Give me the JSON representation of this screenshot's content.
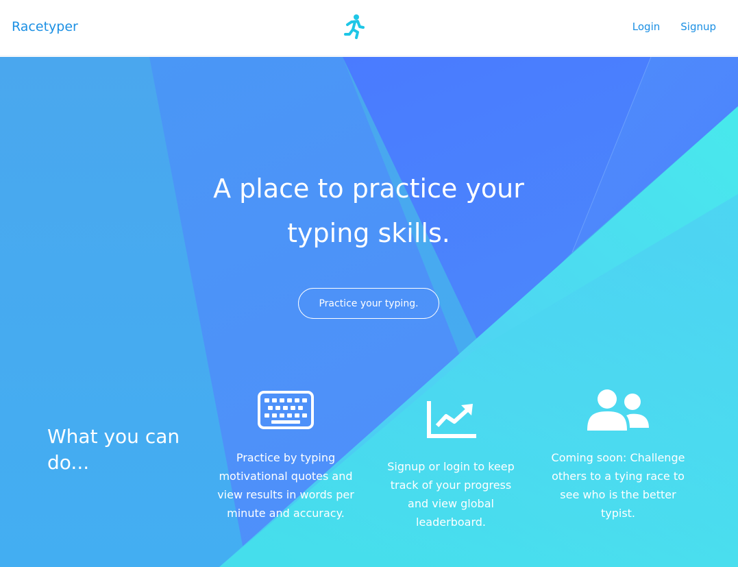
{
  "nav": {
    "brand": "Racetyper",
    "logo_icon": "runner-icon",
    "login_label": "Login",
    "signup_label": "Signup"
  },
  "hero": {
    "headline_line1": "A place to practice your",
    "headline_line2": "typing skills.",
    "cta_label": "Practice your typing."
  },
  "features": {
    "section_title": "What you can do...",
    "items": [
      {
        "icon": "keyboard-icon",
        "text": "Practice by typing motivational quotes and view results in words per minute and accuracy."
      },
      {
        "icon": "chart-line-icon",
        "text": "Signup or login to keep track of your progress and view global leaderboard."
      },
      {
        "icon": "users-icon",
        "text": "Coming soon: Challenge others to a tying race to see who is the better typist."
      }
    ]
  },
  "colors": {
    "brand_blue": "#1a8fe3",
    "logo_cyan": "#1ec6e6",
    "hero_blue": "#46a9f0",
    "hero_deep_blue": "#4a7cff",
    "hero_cyan": "#45f0e8"
  }
}
